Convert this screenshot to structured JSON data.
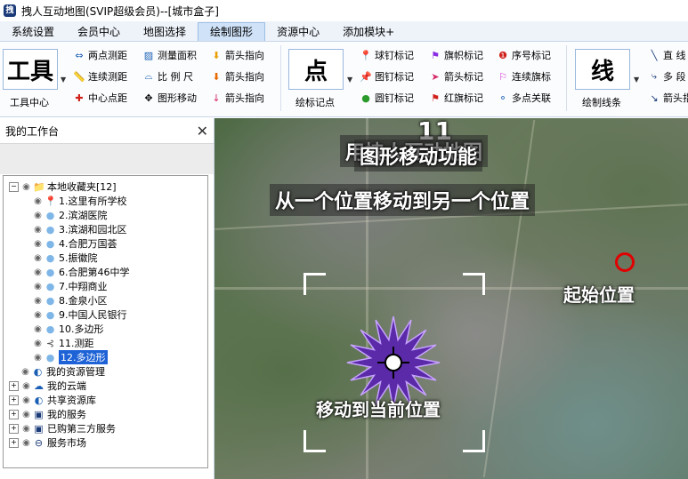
{
  "window": {
    "title": "拽人互动地图(SVIP超级会员)--[城市盒子]",
    "app_icon": "拽"
  },
  "menu": [
    "系统设置",
    "会员中心",
    "地图选择",
    "绘制图形",
    "资源中心",
    "添加模块+"
  ],
  "ribbon": {
    "tools_label": "工具",
    "tools_center": "工具中心",
    "tool_btns": [
      "两点测距",
      "测量面积",
      "箭头指向",
      "连续测距",
      "比 例 尺",
      "箭头指向",
      "中心点距",
      "图形移动",
      "箭头指向"
    ],
    "point_label": "点",
    "point_center": "绘标记点",
    "mark_btns": [
      "球钉标记",
      "旗帜标记",
      "序号标记",
      "图钉标记",
      "箭头标记",
      "连续旗标",
      "圆钉标记",
      "红旗标记",
      "多点关联"
    ],
    "line_label": "线",
    "line_center": "绘制线条",
    "line_btns": [
      "直 线",
      "多 段",
      "箭头指"
    ]
  },
  "panel": {
    "title": "我的工作台",
    "tree": [
      {
        "label": "本地收藏夹[12]",
        "icon": "folder-icon"
      },
      {
        "label": "1.这里有所学校",
        "icon": "pin-icon"
      },
      {
        "label": "2.滨湖医院",
        "icon": "bubble-icon"
      },
      {
        "label": "3.滨湖和园北区",
        "icon": "bubble-icon"
      },
      {
        "label": "4.合肥万国荟",
        "icon": "bubble-icon"
      },
      {
        "label": "5.振徽院",
        "icon": "bubble-icon"
      },
      {
        "label": "6.合肥第46中学",
        "icon": "bubble-icon"
      },
      {
        "label": "7.中翔商业",
        "icon": "bubble-icon"
      },
      {
        "label": "8.金泉小区",
        "icon": "bubble-icon"
      },
      {
        "label": "9.中国人民银行",
        "icon": "bubble-icon"
      },
      {
        "label": "10.多边形",
        "icon": "bubble-icon"
      },
      {
        "label": "11.测距",
        "icon": "ruler-icon"
      },
      {
        "label": "12.多边形",
        "icon": "bubble-icon"
      },
      {
        "label": "我的资源管理",
        "icon": "share-icon"
      },
      {
        "label": "我的云端",
        "icon": "cloud-icon"
      },
      {
        "label": "共享资源库",
        "icon": "share-icon"
      },
      {
        "label": "我的服务",
        "icon": "service-icon"
      },
      {
        "label": "已购第三方服务",
        "icon": "service-icon"
      },
      {
        "label": "服务市场",
        "icon": "market-icon"
      }
    ]
  },
  "map": {
    "step_number": "11",
    "caption_1": "用拽人互动地图",
    "caption_2": "图形移动功能",
    "caption_3": "从一个位置移动到另一个位置",
    "start_label": "起始位置",
    "target_label": "移动到当前位置"
  },
  "colors": {
    "accent": "#1d62d6",
    "start_ring": "#e00000",
    "polygon": "#5a2aa8"
  }
}
